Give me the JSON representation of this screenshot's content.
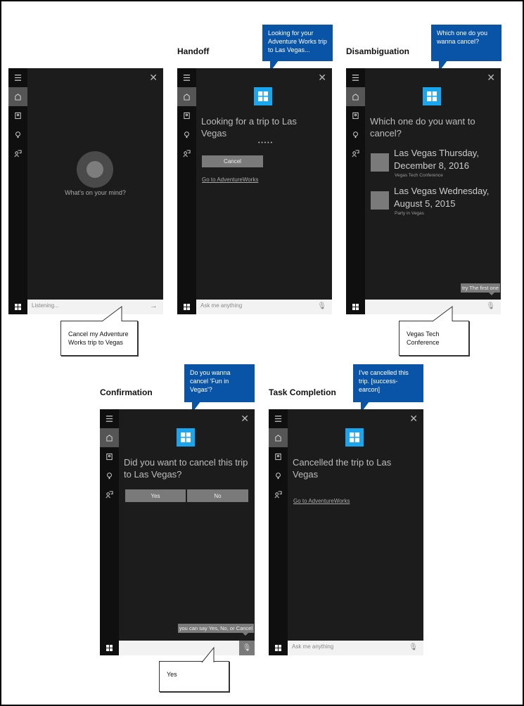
{
  "screens": [
    {
      "id": "listening",
      "title": "",
      "prompt": "What's on your mind?",
      "search_text": "Listening...",
      "user_callout": "Cancel my Adventure Works trip to Vegas"
    },
    {
      "id": "handoff",
      "title": "Handoff",
      "assistant_callout": "Looking for your Adventure Works trip to Las Vegas...",
      "headline": "Looking for a trip to Las Vegas",
      "progress_dots": "• • • •   •",
      "cancel_button": "Cancel",
      "link": "Go to AdventureWorks",
      "search_placeholder": "Ask me anything"
    },
    {
      "id": "disambiguation",
      "title": "Disambiguation",
      "assistant_callout": "Which one do you wanna cancel?",
      "headline": "Which one do you want to cancel?",
      "items": [
        {
          "title": "Las Vegas Thursday, December 8, 2016",
          "subtitle": "Vegas Tech Conference"
        },
        {
          "title": "Las Vegas Wednesday, August 5, 2015",
          "subtitle": "Party in Vegas"
        }
      ],
      "hint": "try The first one",
      "user_callout": "Vegas Tech Conference"
    },
    {
      "id": "confirmation",
      "title": "Confirmation",
      "assistant_callout": "Do you wanna cancel 'Fun in Vegas'?",
      "headline": "Did you want to cancel this trip to Las Vegas?",
      "yes_button": "Yes",
      "no_button": "No",
      "hint": "you can say Yes, No, or Cancel",
      "user_callout": "Yes"
    },
    {
      "id": "task-completion",
      "title": "Task Completion",
      "assistant_callout": "I've cancelled this trip. [success-earcon]",
      "headline": "Cancelled the trip to Las Vegas",
      "link": "Go to AdventureWorks",
      "search_placeholder": "Ask me anything"
    }
  ],
  "icons": {
    "menu": "hamburger-icon",
    "home": "home-icon",
    "notebook": "notebook-icon",
    "reminders": "lightbulb-icon",
    "feedback": "feedback-icon",
    "close": "close-icon",
    "start": "windows-start-icon",
    "mic": "microphone-icon",
    "submit": "arrow-right-icon"
  },
  "colors": {
    "assistant_callout": "#0a54a8",
    "panel_bg": "#1c1c1c",
    "sidebar_bg": "#0f0f0f",
    "app_tile": "#1aa6ef",
    "button_gray": "#7a7a7a"
  }
}
